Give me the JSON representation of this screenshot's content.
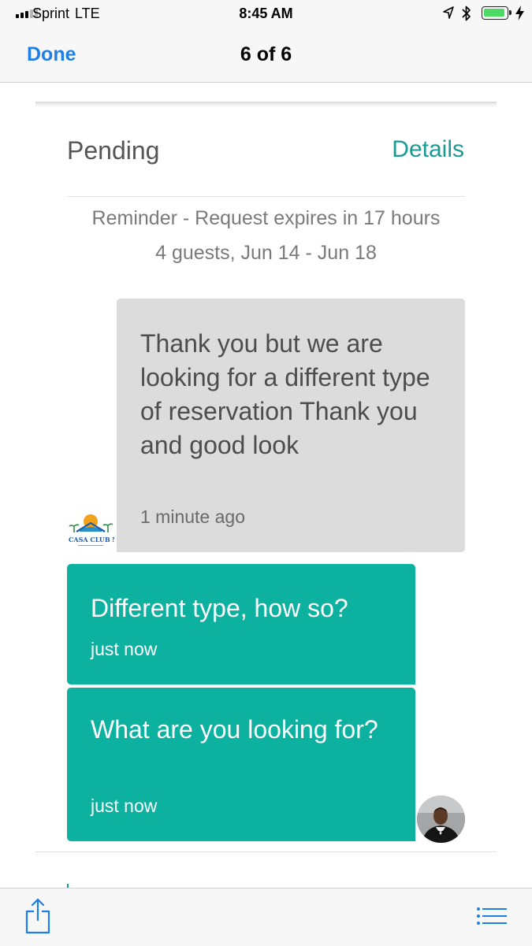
{
  "status_bar": {
    "carrier": "Sprint",
    "network": "LTE",
    "time": "8:45 AM",
    "battery_color": "#4cd964"
  },
  "nav": {
    "done_label": "Done",
    "title": "6 of 6"
  },
  "reservation": {
    "status": "Pending",
    "details_link": "Details",
    "reminder": "Reminder - Request expires in 17 hours",
    "summary": "4 guests, Jun 14 - Jun 18"
  },
  "messages": [
    {
      "text": "Thank you but we are looking for a different type of reservation Thank you and good look",
      "time": "1 minute ago",
      "sender": "host",
      "avatar_label": "CASA CLUB MI"
    },
    {
      "text": "Different type, how so?",
      "time": "just now",
      "sender": "me"
    },
    {
      "text": "What are you looking for?",
      "time": "just now",
      "sender": "me"
    }
  ],
  "toolbar": {
    "share_icon": "share-icon",
    "list_icon": "list-icon"
  },
  "colors": {
    "accent_teal": "#0cb1a0",
    "link_teal": "#1a9a92",
    "ios_blue": "#1f7fe5"
  }
}
